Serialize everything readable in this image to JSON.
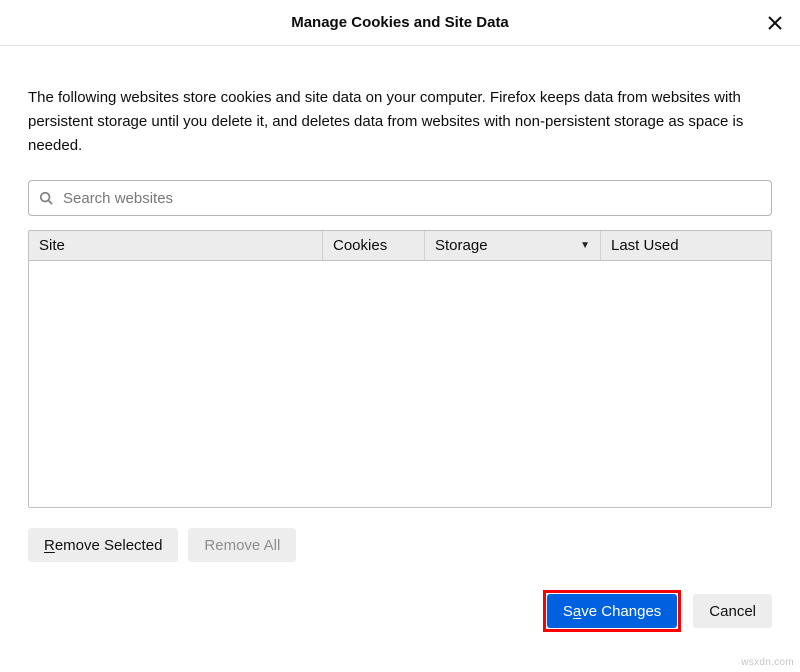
{
  "title": "Manage Cookies and Site Data",
  "intro": "The following websites store cookies and site data on your computer. Firefox keeps data from websites with persistent storage until you delete it, and deletes data from websites with non-persistent storage as space is needed.",
  "search": {
    "placeholder": "Search websites"
  },
  "columns": {
    "site": "Site",
    "cookies": "Cookies",
    "storage": "Storage",
    "last_used": "Last Used"
  },
  "buttons": {
    "remove_selected_prefix": "R",
    "remove_selected_suffix": "emove Selected",
    "remove_all": "Remove All",
    "save_prefix": "S",
    "save_mid": "a",
    "save_suffix": "ve Changes",
    "cancel": "Cancel"
  },
  "watermark": "wsxdn.com"
}
